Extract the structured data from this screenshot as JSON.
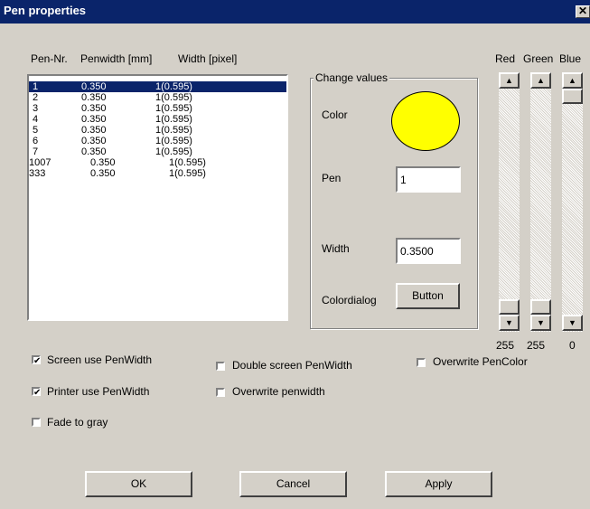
{
  "window": {
    "title": "Pen properties",
    "close_symbol": "✕"
  },
  "list": {
    "headers": [
      "Pen-Nr.",
      "Penwidth [mm]",
      "Width [pixel]"
    ],
    "rows": [
      {
        "nr": "1",
        "mm": "0.350",
        "px": "1(0.595)",
        "selected": true
      },
      {
        "nr": "2",
        "mm": "0.350",
        "px": "1(0.595)"
      },
      {
        "nr": "3",
        "mm": "0.350",
        "px": "1(0.595)"
      },
      {
        "nr": "4",
        "mm": "0.350",
        "px": "1(0.595)"
      },
      {
        "nr": "5",
        "mm": "0.350",
        "px": "1(0.595)"
      },
      {
        "nr": "6",
        "mm": "0.350",
        "px": "1(0.595)"
      },
      {
        "nr": "7",
        "mm": "0.350",
        "px": "1(0.595)"
      },
      {
        "nr": "1007",
        "mm": "0.350",
        "px": "1(0.595)"
      },
      {
        "nr": "333",
        "mm": "0.350",
        "px": "1(0.595)"
      }
    ]
  },
  "change_values": {
    "label": "Change values",
    "color_label": "Color",
    "color_value": "#ffff00",
    "pen_label": "Pen",
    "pen_value": "1",
    "width_label": "Width",
    "width_value": "0.3500",
    "colordialog_label": "Colordialog",
    "button_label": "Button"
  },
  "rgb": {
    "labels": [
      "Red",
      "Green",
      "Blue"
    ],
    "values": [
      "255",
      "255",
      "0"
    ],
    "levels": [
      1.0,
      1.0,
      0.0
    ]
  },
  "checkboxes": [
    {
      "label": "Screen use PenWidth",
      "checked": true
    },
    {
      "label": "Printer use PenWidth",
      "checked": true
    },
    {
      "label": "Fade to gray",
      "checked": false
    },
    {
      "label": "Double screen PenWidth",
      "checked": false
    },
    {
      "label": "Overwrite penwidth",
      "checked": false
    },
    {
      "label": "Overwrite PenColor",
      "checked": false
    }
  ],
  "buttons": {
    "ok": "OK",
    "cancel": "Cancel",
    "apply": "Apply"
  },
  "icons": {
    "scroll_up": "▲",
    "scroll_down": "▼",
    "check": "✔"
  }
}
